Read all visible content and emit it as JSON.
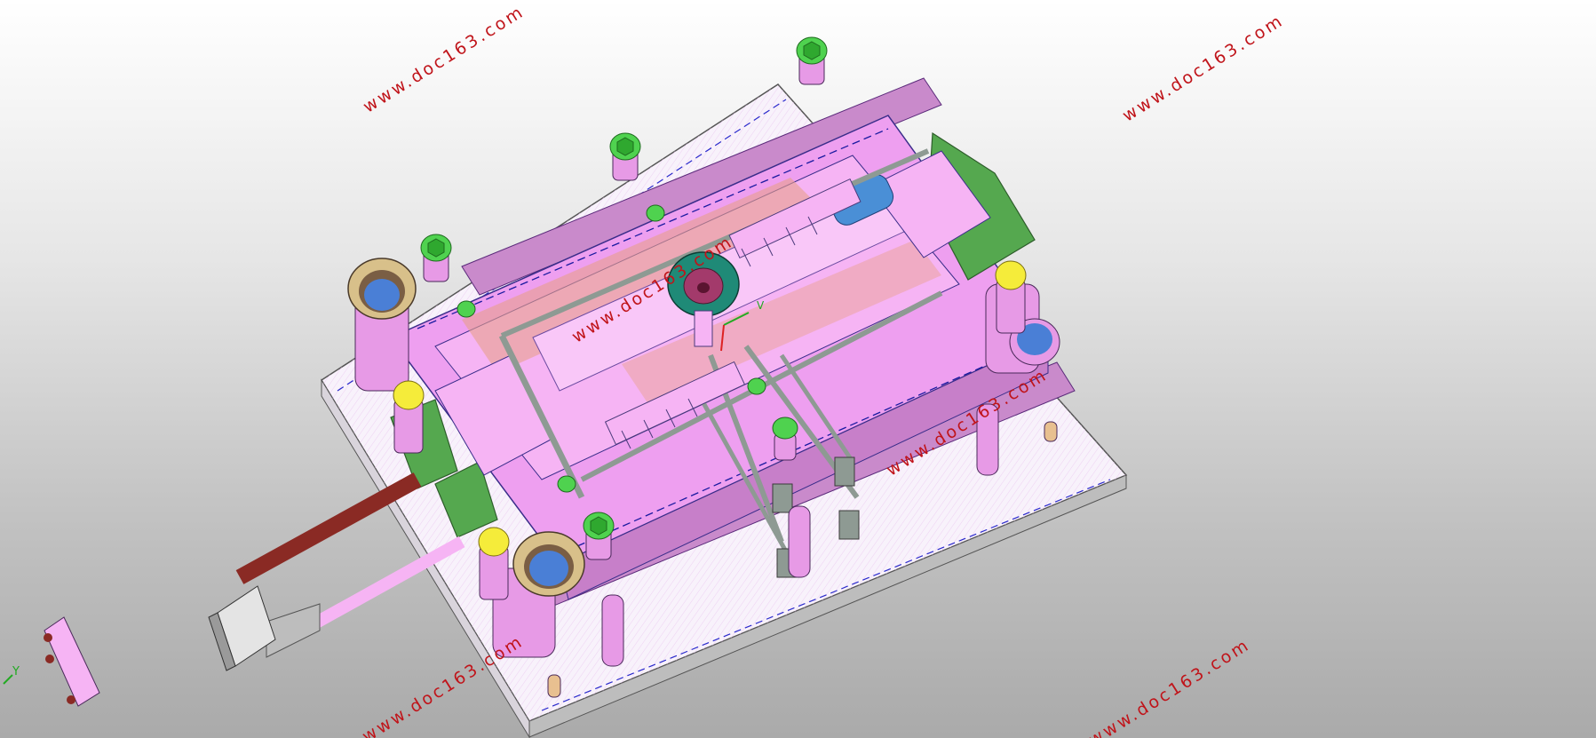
{
  "viewport": {
    "background_top": "#ffffff",
    "background_bottom": "#aaaaaa"
  },
  "model": {
    "part_color": "#f2a6f0",
    "plate_color": "#ffffff",
    "insert_color": "#55a84f",
    "screw_head_color": "#4fd24f",
    "post_cap_color": "#f5ec3a",
    "rod_color": "#8a2a24",
    "bore_color": "#4a7fd6",
    "gate_color": "#1f8a77",
    "edge_color": "#1a1aa0"
  },
  "triad": {
    "y_label": "Y",
    "v_label": "V"
  },
  "watermarks": [
    {
      "text": "www.doc163.com"
    },
    {
      "text": "www.doc163.com"
    },
    {
      "text": "www.doc163.com"
    },
    {
      "text": "www.doc163.com"
    },
    {
      "text": "www.doc163.com"
    },
    {
      "text": "www.doc163.com"
    }
  ]
}
